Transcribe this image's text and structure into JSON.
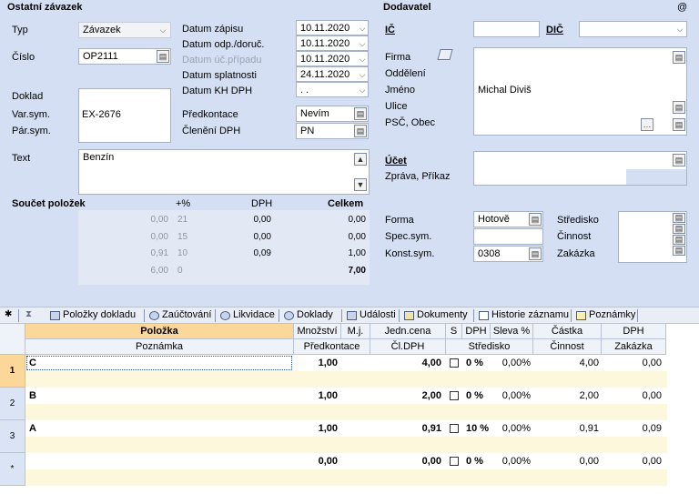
{
  "left": {
    "title": "Ostatní závazek",
    "typ": {
      "label": "Typ",
      "value": "Závazek"
    },
    "cislo": {
      "label": "Číslo",
      "value": "OP2111"
    },
    "doklad": {
      "label": "Doklad",
      "varsym_label": "Var.sym.",
      "varsym_value": "EX-2676",
      "parsym_label": "Pár.sym."
    },
    "text": {
      "label": "Text",
      "value": "Benzín"
    },
    "dates": [
      {
        "label": "Datum zápisu",
        "value": "10.11.2020"
      },
      {
        "label": "Datum odp./doruč.",
        "value": "10.11.2020"
      },
      {
        "label": "Datum úč.případu",
        "value": "10.11.2020"
      },
      {
        "label": "Datum splatnosti",
        "value": "24.11.2020"
      },
      {
        "label": "Datum KH DPH",
        "value": ". ."
      }
    ],
    "predkontace": {
      "label": "Předkontace",
      "value": "Nevím"
    },
    "cleneni": {
      "label": "Členění DPH",
      "value": "PN"
    }
  },
  "soucet": {
    "title": "Součet položek",
    "headers": [
      "+%",
      "DPH",
      "Celkem"
    ],
    "rows": [
      {
        "base": "0,00",
        "pct": "21",
        "dph": "0,00",
        "celkem": "0,00"
      },
      {
        "base": "0,00",
        "pct": "15",
        "dph": "0,00",
        "celkem": "0,00"
      },
      {
        "base": "0,91",
        "pct": "10",
        "dph": "0,09",
        "celkem": "1,00"
      },
      {
        "base": "6,00",
        "pct": "0",
        "dph": "",
        "celkem": "7,00"
      }
    ]
  },
  "right": {
    "title": "Dodavatel",
    "at": "@",
    "ic_label": "IČ",
    "dic_label": "DIČ",
    "firma_label": "Firma",
    "oddeleni_label": "Oddělení",
    "jmeno_label": "Jméno",
    "jmeno_value": "Michal Diviš",
    "ulice_label": "Ulice",
    "psc_label": "PSČ, Obec",
    "ucet_label": "Účet",
    "zprava_label": "Zpráva, Příkaz",
    "forma": {
      "label": "Forma",
      "value": "Hotově"
    },
    "spec_label": "Spec.sym.",
    "konst": {
      "label": "Konst.sym.",
      "value": "0308"
    },
    "stredisko_label": "Středisko",
    "cinnost_label": "Činnost",
    "zakazka_label": "Zakázka"
  },
  "tabs": [
    "Položky dokladu",
    "Zaúčtování",
    "Likvidace",
    "Doklady",
    "Události",
    "Dokumenty",
    "Historie záznamu",
    "Poznámky"
  ],
  "grid": {
    "header1": [
      "Položka",
      "Množství",
      "M.j.",
      "Jedn.cena",
      "S",
      "DPH",
      "Sleva %",
      "Částka",
      "DPH"
    ],
    "header2": [
      "Poznámka",
      "Předkontace",
      "Čl.DPH",
      "Středisko",
      "Činnost",
      "Zakázka"
    ],
    "rows": [
      {
        "num": "1",
        "polozka": "C",
        "mnozstvi": "1,00",
        "cena": "4,00",
        "dph": "0 %",
        "sleva": "0,00%",
        "castka": "4,00",
        "dph2": "0,00"
      },
      {
        "num": "2",
        "polozka": "B",
        "mnozstvi": "1,00",
        "cena": "2,00",
        "dph": "0 %",
        "sleva": "0,00%",
        "castka": "2,00",
        "dph2": "0,00"
      },
      {
        "num": "3",
        "polozka": "A",
        "mnozstvi": "1,00",
        "cena": "0,91",
        "dph": "10 %",
        "sleva": "0,00%",
        "castka": "0,91",
        "dph2": "0,09"
      },
      {
        "num": "*",
        "polozka": "",
        "mnozstvi": "0,00",
        "cena": "0,00",
        "dph": "0 %",
        "sleva": "0,00%",
        "castka": "0,00",
        "dph2": "0,00"
      }
    ]
  }
}
